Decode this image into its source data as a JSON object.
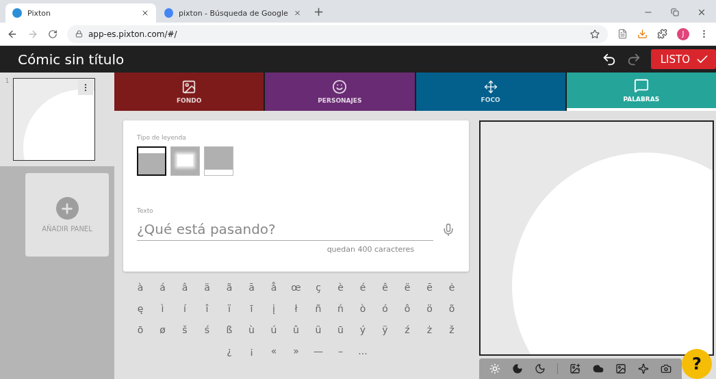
{
  "browser": {
    "tabs": [
      {
        "title": "Pixton",
        "selected": true,
        "kind": "pixton"
      },
      {
        "title": "pixton - Búsqueda de Google",
        "selected": false,
        "kind": "google"
      }
    ],
    "new_tab": "+",
    "url": "app-es.pixton.com/#/",
    "profile": "J"
  },
  "header": {
    "title": "Cómic sin título",
    "done": "LISTO"
  },
  "panels": [
    {
      "number": "1",
      "selected": true
    }
  ],
  "add_panel": "AÑADIR PANEL",
  "tabs": [
    {
      "label": "FONDO",
      "kind": "background",
      "color": "#7d1b1b",
      "selected": false
    },
    {
      "label": "PERSONAJES",
      "kind": "characters",
      "color": "#692b73",
      "selected": false
    },
    {
      "label": "FOCO",
      "kind": "focus",
      "color": "#03608d",
      "selected": false
    },
    {
      "label": "PALABRAS",
      "kind": "words",
      "color": "#25a59a",
      "selected": true
    }
  ],
  "caption": {
    "label": "Tipo de leyenda",
    "types": [
      {
        "kind": "top",
        "selected": true
      },
      {
        "kind": "burst",
        "selected": false
      },
      {
        "kind": "bottom",
        "selected": false
      }
    ]
  },
  "text": {
    "label": "Texto",
    "placeholder": "¿Qué está pasando?",
    "counter": "quedan 400 caracteres"
  },
  "characters": [
    [
      "à",
      "á",
      "â",
      "ä",
      "ã",
      "ā",
      "å",
      "œ",
      "ç",
      "è",
      "é",
      "ê",
      "ë",
      "ē",
      "ė"
    ],
    [
      "ę",
      "ì",
      "í",
      "î",
      "ï",
      "ī",
      "į",
      "ł",
      "ñ",
      "ń",
      "ò",
      "ó",
      "ô",
      "ö",
      "õ"
    ],
    [
      "ō",
      "ø",
      "š",
      "ś",
      "ß",
      "ù",
      "ú",
      "û",
      "ü",
      "ū",
      "ý",
      "ÿ",
      "ź",
      "ż",
      "ž"
    ],
    [
      "¿",
      "¡",
      "«",
      "»",
      "—",
      "–",
      "..."
    ]
  ],
  "help": "?"
}
